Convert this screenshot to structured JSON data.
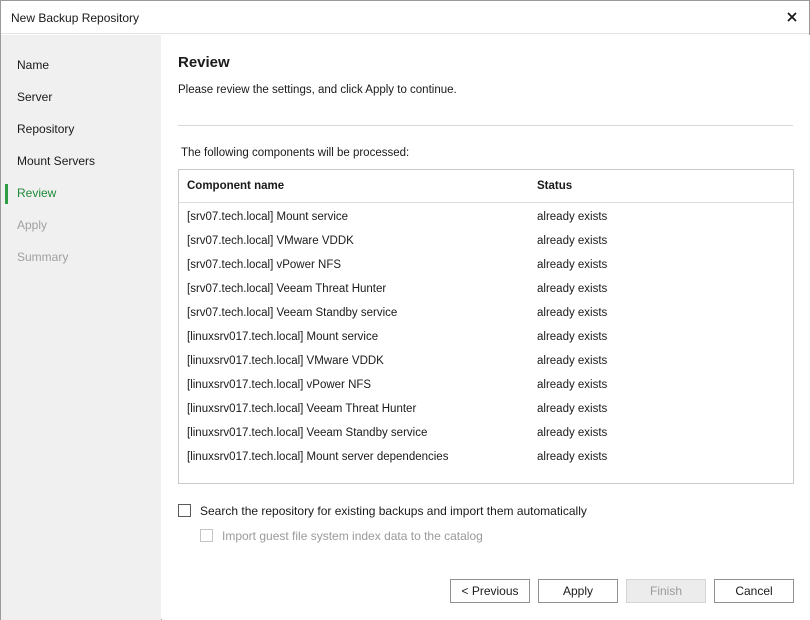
{
  "window": {
    "title": "New Backup Repository"
  },
  "icons": {
    "close": "close-icon"
  },
  "sidebar": {
    "items": [
      {
        "label": "Name",
        "state": "normal"
      },
      {
        "label": "Server",
        "state": "normal"
      },
      {
        "label": "Repository",
        "state": "normal"
      },
      {
        "label": "Mount Servers",
        "state": "normal"
      },
      {
        "label": "Review",
        "state": "active"
      },
      {
        "label": "Apply",
        "state": "disabled"
      },
      {
        "label": "Summary",
        "state": "disabled"
      }
    ]
  },
  "page": {
    "title": "Review",
    "subtitle": "Please review the settings, and click Apply to continue.",
    "components_label": "The following components will be processed:"
  },
  "table": {
    "columns": [
      "Component name",
      "Status"
    ],
    "rows": [
      {
        "name": "[srv07.tech.local] Mount service",
        "status": "already exists"
      },
      {
        "name": "[srv07.tech.local] VMware VDDK",
        "status": "already exists"
      },
      {
        "name": "[srv07.tech.local] vPower NFS",
        "status": "already exists"
      },
      {
        "name": "[srv07.tech.local] Veeam Threat Hunter",
        "status": "already exists"
      },
      {
        "name": "[srv07.tech.local] Veeam Standby service",
        "status": "already exists"
      },
      {
        "name": "[linuxsrv017.tech.local] Mount service",
        "status": "already exists"
      },
      {
        "name": "[linuxsrv017.tech.local] VMware VDDK",
        "status": "already exists"
      },
      {
        "name": "[linuxsrv017.tech.local] vPower NFS",
        "status": "already exists"
      },
      {
        "name": "[linuxsrv017.tech.local] Veeam Threat Hunter",
        "status": "already exists"
      },
      {
        "name": "[linuxsrv017.tech.local] Veeam Standby service",
        "status": "already exists"
      },
      {
        "name": "[linuxsrv017.tech.local] Mount server dependencies",
        "status": "already exists"
      }
    ]
  },
  "options": {
    "search_import": {
      "label": "Search the repository for existing backups and import them automatically",
      "checked": false
    },
    "import_index": {
      "label": "Import guest file system index data to the catalog",
      "checked": false,
      "enabled": false
    }
  },
  "buttons": {
    "previous": "< Previous",
    "apply": "Apply",
    "finish": "Finish",
    "cancel": "Cancel"
  },
  "colors": {
    "accent": "#2e9e46",
    "active_text": "#1e8a3a",
    "sidebar_bg": "#f0f0f0",
    "disabled_text": "#a0a0a0"
  }
}
